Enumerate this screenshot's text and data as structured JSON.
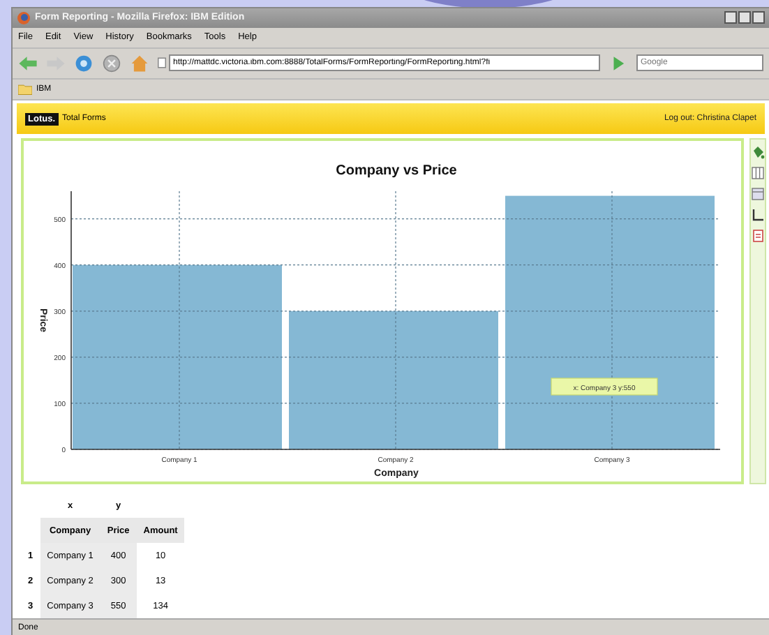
{
  "window": {
    "title": "Form Reporting - Mozilla Firefox: IBM Edition"
  },
  "menu": [
    "File",
    "Edit",
    "View",
    "History",
    "Bookmarks",
    "Tools",
    "Help"
  ],
  "address_bar": {
    "value": "http://mattdc.victoria.ibm.com:8888/TotalForms/FormReporting/FormReporting.html?fi"
  },
  "search": {
    "placeholder": "Google"
  },
  "bookmarks": [
    "IBM"
  ],
  "banner": {
    "logo": "Lotus.",
    "product": "Total Forms",
    "user_link": "Log out: Christina Clapet"
  },
  "chart": {
    "chart_data": {
      "type": "bar",
      "title": "Company vs Price",
      "xlabel": "Company",
      "ylabel": "Price",
      "categories": [
        "Company 1",
        "Company 2",
        "Company 3"
      ],
      "values": [
        400,
        300,
        550
      ],
      "grid": true,
      "ylim": [
        0,
        560
      ],
      "yticks": [
        0,
        100,
        200,
        300,
        400,
        500
      ],
      "annotations": [
        "x: Company 3 y:550"
      ]
    }
  },
  "table": {
    "axis_roles": [
      "x",
      "y"
    ],
    "columns": [
      "Company",
      "Price",
      "Amount"
    ],
    "rows": [
      {
        "index": "1",
        "cells": [
          "Company 1",
          "400",
          "10"
        ]
      },
      {
        "index": "2",
        "cells": [
          "Company 2",
          "300",
          "13"
        ]
      },
      {
        "index": "3",
        "cells": [
          "Company 3",
          "550",
          "134"
        ]
      }
    ]
  },
  "status_bar": "Done"
}
